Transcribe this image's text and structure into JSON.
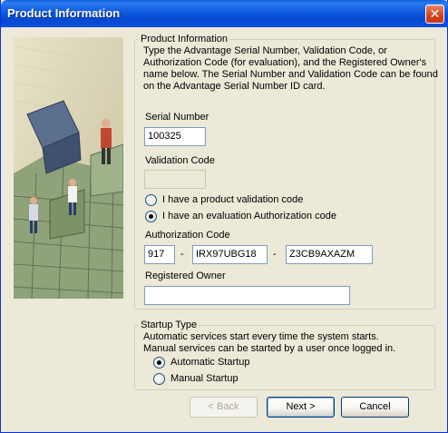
{
  "window": {
    "title": "Product Information",
    "close_glyph": "✕"
  },
  "info_group": {
    "legend": "Product Information",
    "description_lines": [
      "Type the Advantage Serial Number, Validation Code, or",
      "Authorization Code (for evaluation), and the Registered Owner's",
      "name below.  The Serial Number and Validation Code can be found",
      "on the Advantage Serial Number ID card."
    ],
    "serial_label": "Serial Number",
    "serial_value": "100325",
    "validation_label": "Validation Code",
    "validation_value": "",
    "radio_validation": {
      "label": "I have a product validation code",
      "checked": false
    },
    "radio_evaluation": {
      "label": "I have an evaluation Authorization code",
      "checked": true
    },
    "auth_label": "Authorization Code",
    "auth_part1": "917",
    "auth_part2": "IRX97UBG18",
    "auth_part3": "Z3CB9AXAZM",
    "separator": "-",
    "owner_label": "Registered Owner",
    "owner_value": ""
  },
  "startup_group": {
    "legend": "Startup Type",
    "description_lines": [
      "Automatic services start every time the system starts.",
      "Manual services can be started by a user once logged in."
    ],
    "radio_automatic": {
      "label": "Automatic Startup",
      "checked": true
    },
    "radio_manual": {
      "label": "Manual Startup",
      "checked": false
    }
  },
  "buttons": {
    "back": {
      "label": "< Back",
      "enabled": false
    },
    "next": {
      "label": "Next >",
      "enabled": true
    },
    "cancel": {
      "label": "Cancel",
      "enabled": true
    }
  },
  "colors": {
    "title_bar": "#0A5FDC",
    "face": "#ECE9D8",
    "close": "#D4411E"
  },
  "icons": {
    "close": "close-icon",
    "banner": "people-climbing-illustration"
  }
}
